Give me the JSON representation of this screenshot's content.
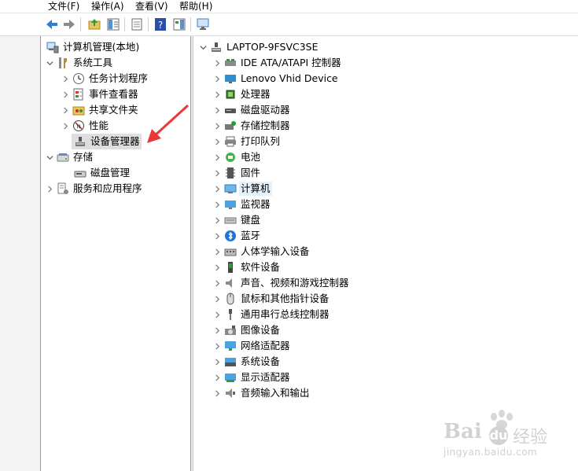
{
  "menu": [
    "文件(F)",
    "操作(A)",
    "查看(V)",
    "帮助(H)"
  ],
  "toolbar": {
    "icons": [
      "back-arrow-icon",
      "forward-arrow-icon",
      "up-folder-icon",
      "show-hide-tree-icon",
      "properties-icon",
      "help-icon",
      "action-pane-icon",
      "monitor-icon"
    ]
  },
  "left_tree": {
    "root": "计算机管理(本地)",
    "system_tools": "系统工具",
    "task_scheduler": "任务计划程序",
    "event_viewer": "事件查看器",
    "shared_folders": "共享文件夹",
    "performance": "性能",
    "device_manager": "设备管理器",
    "storage": "存储",
    "disk_management": "磁盘管理",
    "services_apps": "服务和应用程序"
  },
  "right_tree": {
    "computer_name": "LAPTOP-9FSVC3SE",
    "categories": [
      "IDE ATA/ATAPI 控制器",
      "Lenovo Vhid Device",
      "处理器",
      "磁盘驱动器",
      "存储控制器",
      "打印队列",
      "电池",
      "固件",
      "计算机",
      "监视器",
      "键盘",
      "蓝牙",
      "人体学输入设备",
      "软件设备",
      "声音、视频和游戏控制器",
      "鼠标和其他指针设备",
      "通用串行总线控制器",
      "图像设备",
      "网络适配器",
      "系统设备",
      "显示适配器",
      "音频输入和输出"
    ],
    "highlighted_index": 8
  },
  "watermark": {
    "brand": "Bai",
    "brand2": "经验",
    "url": "jingyan.baidu.com"
  },
  "colors": {
    "accent_arrow": "#e8393a",
    "selection": "#dedede",
    "hover": "#e5f1fb"
  }
}
